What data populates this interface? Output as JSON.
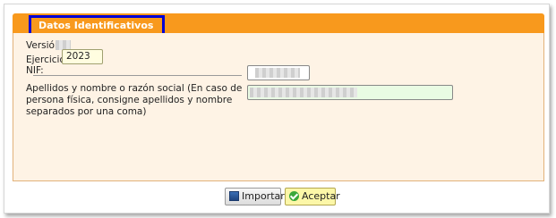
{
  "section": {
    "title": "Datos Identificativos"
  },
  "fields": {
    "version_label": "Versión",
    "ejercicio_label": "Ejercicio",
    "ejercicio_value": "2023",
    "nif_label": "NIF:",
    "name_label": "Apellidos y nombre o razón social (En caso de persona física, consigne apellidos y nombre separados por una coma)"
  },
  "buttons": {
    "import_label": "Importar",
    "accept_label": "Aceptar"
  },
  "colors": {
    "header": "#f8991d",
    "panel": "#fef3e5",
    "highlight_border": "#0000d6",
    "accept_bg": "#fcf7a8",
    "name_field_bg": "#e9fbe3"
  }
}
